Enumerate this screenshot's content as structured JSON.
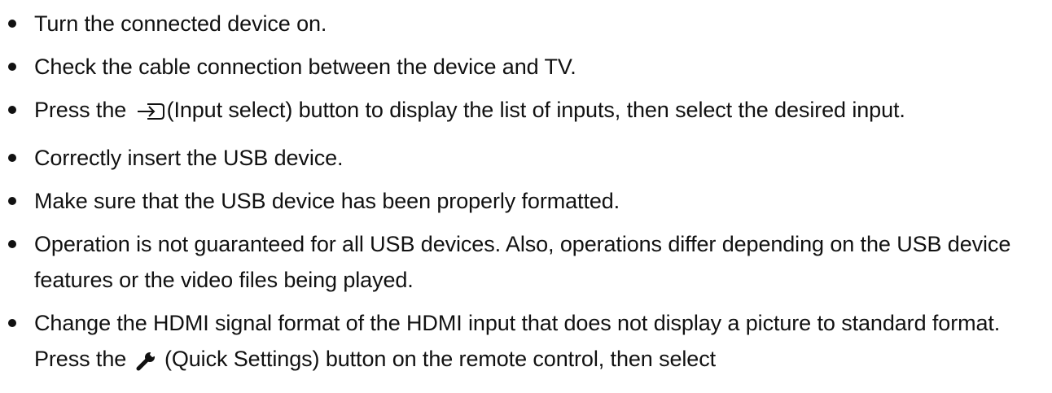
{
  "list": {
    "items": [
      {
        "text": "Turn the connected device on."
      },
      {
        "text": "Check the cable connection between the device and TV."
      },
      {
        "before": "Press the ",
        "icon": "input-select-icon",
        "after": "(Input select) button to display the list of inputs, then select the desired input."
      },
      {
        "text": "Correctly insert the USB device."
      },
      {
        "text": "Make sure that the USB device has been properly formatted."
      },
      {
        "text": "Operation is not guaranteed for all USB devices. Also, operations differ depending on the USB device features or the video files being played."
      },
      {
        "before": "Change the HDMI signal format of the HDMI input that does not display a picture to standard format. Press the ",
        "icon": "wrench-icon",
        "after": " (Quick Settings) button on the remote control, then select"
      }
    ]
  }
}
